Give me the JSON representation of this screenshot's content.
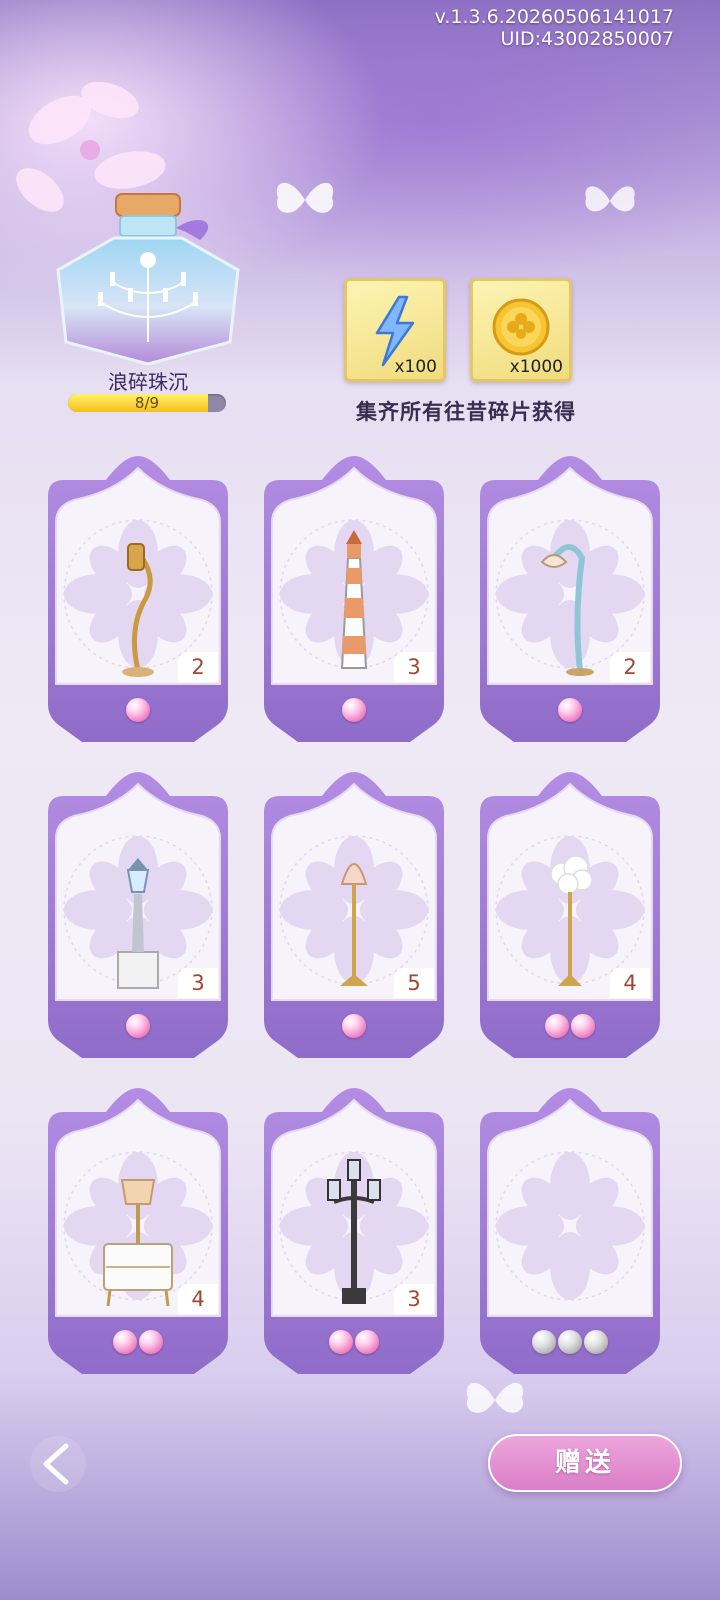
{
  "header": {
    "version": "v.1.3.6.20260506141017",
    "uid": "UID:43002850007"
  },
  "collection": {
    "title": "浪碎珠沉",
    "progress_text": "8/9",
    "progress_fraction": 0.889
  },
  "rewards": [
    {
      "icon": "lightning-energy-icon",
      "amount": "x100"
    },
    {
      "icon": "gold-clover-coin-icon",
      "amount": "x1000"
    }
  ],
  "reward_caption": "集齐所有往昔碎片获得",
  "cards": [
    {
      "item": "golden-wall-lantern-lamp",
      "count": "2",
      "pearls": 1,
      "pearl_color": "pink"
    },
    {
      "item": "lighthouse-lamp",
      "count": "3",
      "pearls": 1,
      "pearl_color": "pink"
    },
    {
      "item": "seashell-street-lamp",
      "count": "2",
      "pearls": 1,
      "pearl_color": "pink"
    },
    {
      "item": "statue-pedestal-lamp",
      "count": "3",
      "pearls": 1,
      "pearl_color": "pink"
    },
    {
      "item": "tulip-floor-lamp",
      "count": "5",
      "pearls": 1,
      "pearl_color": "pink"
    },
    {
      "item": "cloud-floor-lamp",
      "count": "4",
      "pearls": 2,
      "pearl_color": "pink"
    },
    {
      "item": "nightstand-table-lamp",
      "count": "4",
      "pearls": 2,
      "pearl_color": "pink"
    },
    {
      "item": "black-triple-street-lamp",
      "count": "3",
      "pearls": 2,
      "pearl_color": "pink"
    },
    {
      "item": "empty-slot",
      "count": "",
      "pearls": 3,
      "pearl_color": "grey"
    }
  ],
  "footer": {
    "back_icon": "chevron-left-icon",
    "send_label": "赠送"
  },
  "colors": {
    "accent": "#9d7ad3",
    "send_button": "#e193d3",
    "count_text": "#a0462e"
  }
}
